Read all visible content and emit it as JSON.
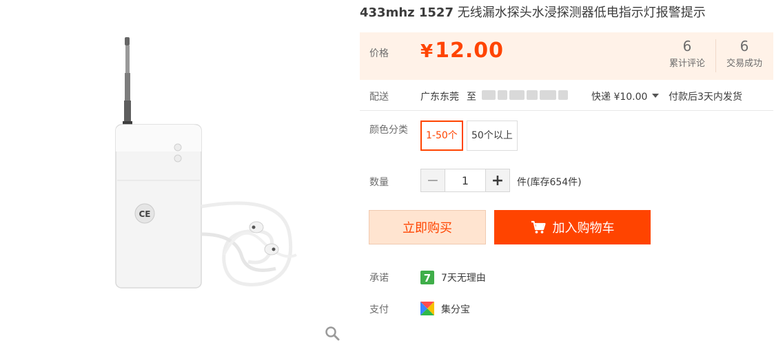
{
  "product": {
    "title_model": "433mhz 1527",
    "title_desc": "无线漏水探头水浸探测器低电指示灯报警提示"
  },
  "price": {
    "label": "价格",
    "currency": "¥",
    "amount": "12.00",
    "color": "#ff4400"
  },
  "stats": [
    {
      "value": "6",
      "label": "累计评论"
    },
    {
      "value": "6",
      "label": "交易成功"
    }
  ],
  "shipping": {
    "label": "配送",
    "from": "广东东莞",
    "to_prefix": "至",
    "method": "快递 ¥10.00",
    "dispatch": "付款后3天内发货"
  },
  "sku": {
    "label": "颜色分类",
    "options": [
      {
        "label": "1-50个",
        "selected": true
      },
      {
        "label": "50个以上",
        "selected": false
      }
    ]
  },
  "quantity": {
    "label": "数量",
    "value": "1",
    "minus": "−",
    "plus": "+",
    "unit_stock": "件(库存654件)"
  },
  "actions": {
    "buy_now": "立即购买",
    "add_to_cart": "加入购物车"
  },
  "promise": {
    "label": "承诺",
    "text": "7天无理由",
    "icon": "seven-day-return-icon"
  },
  "payment": {
    "label": "支付",
    "text": "集分宝",
    "icon": "jifenbao-icon"
  }
}
